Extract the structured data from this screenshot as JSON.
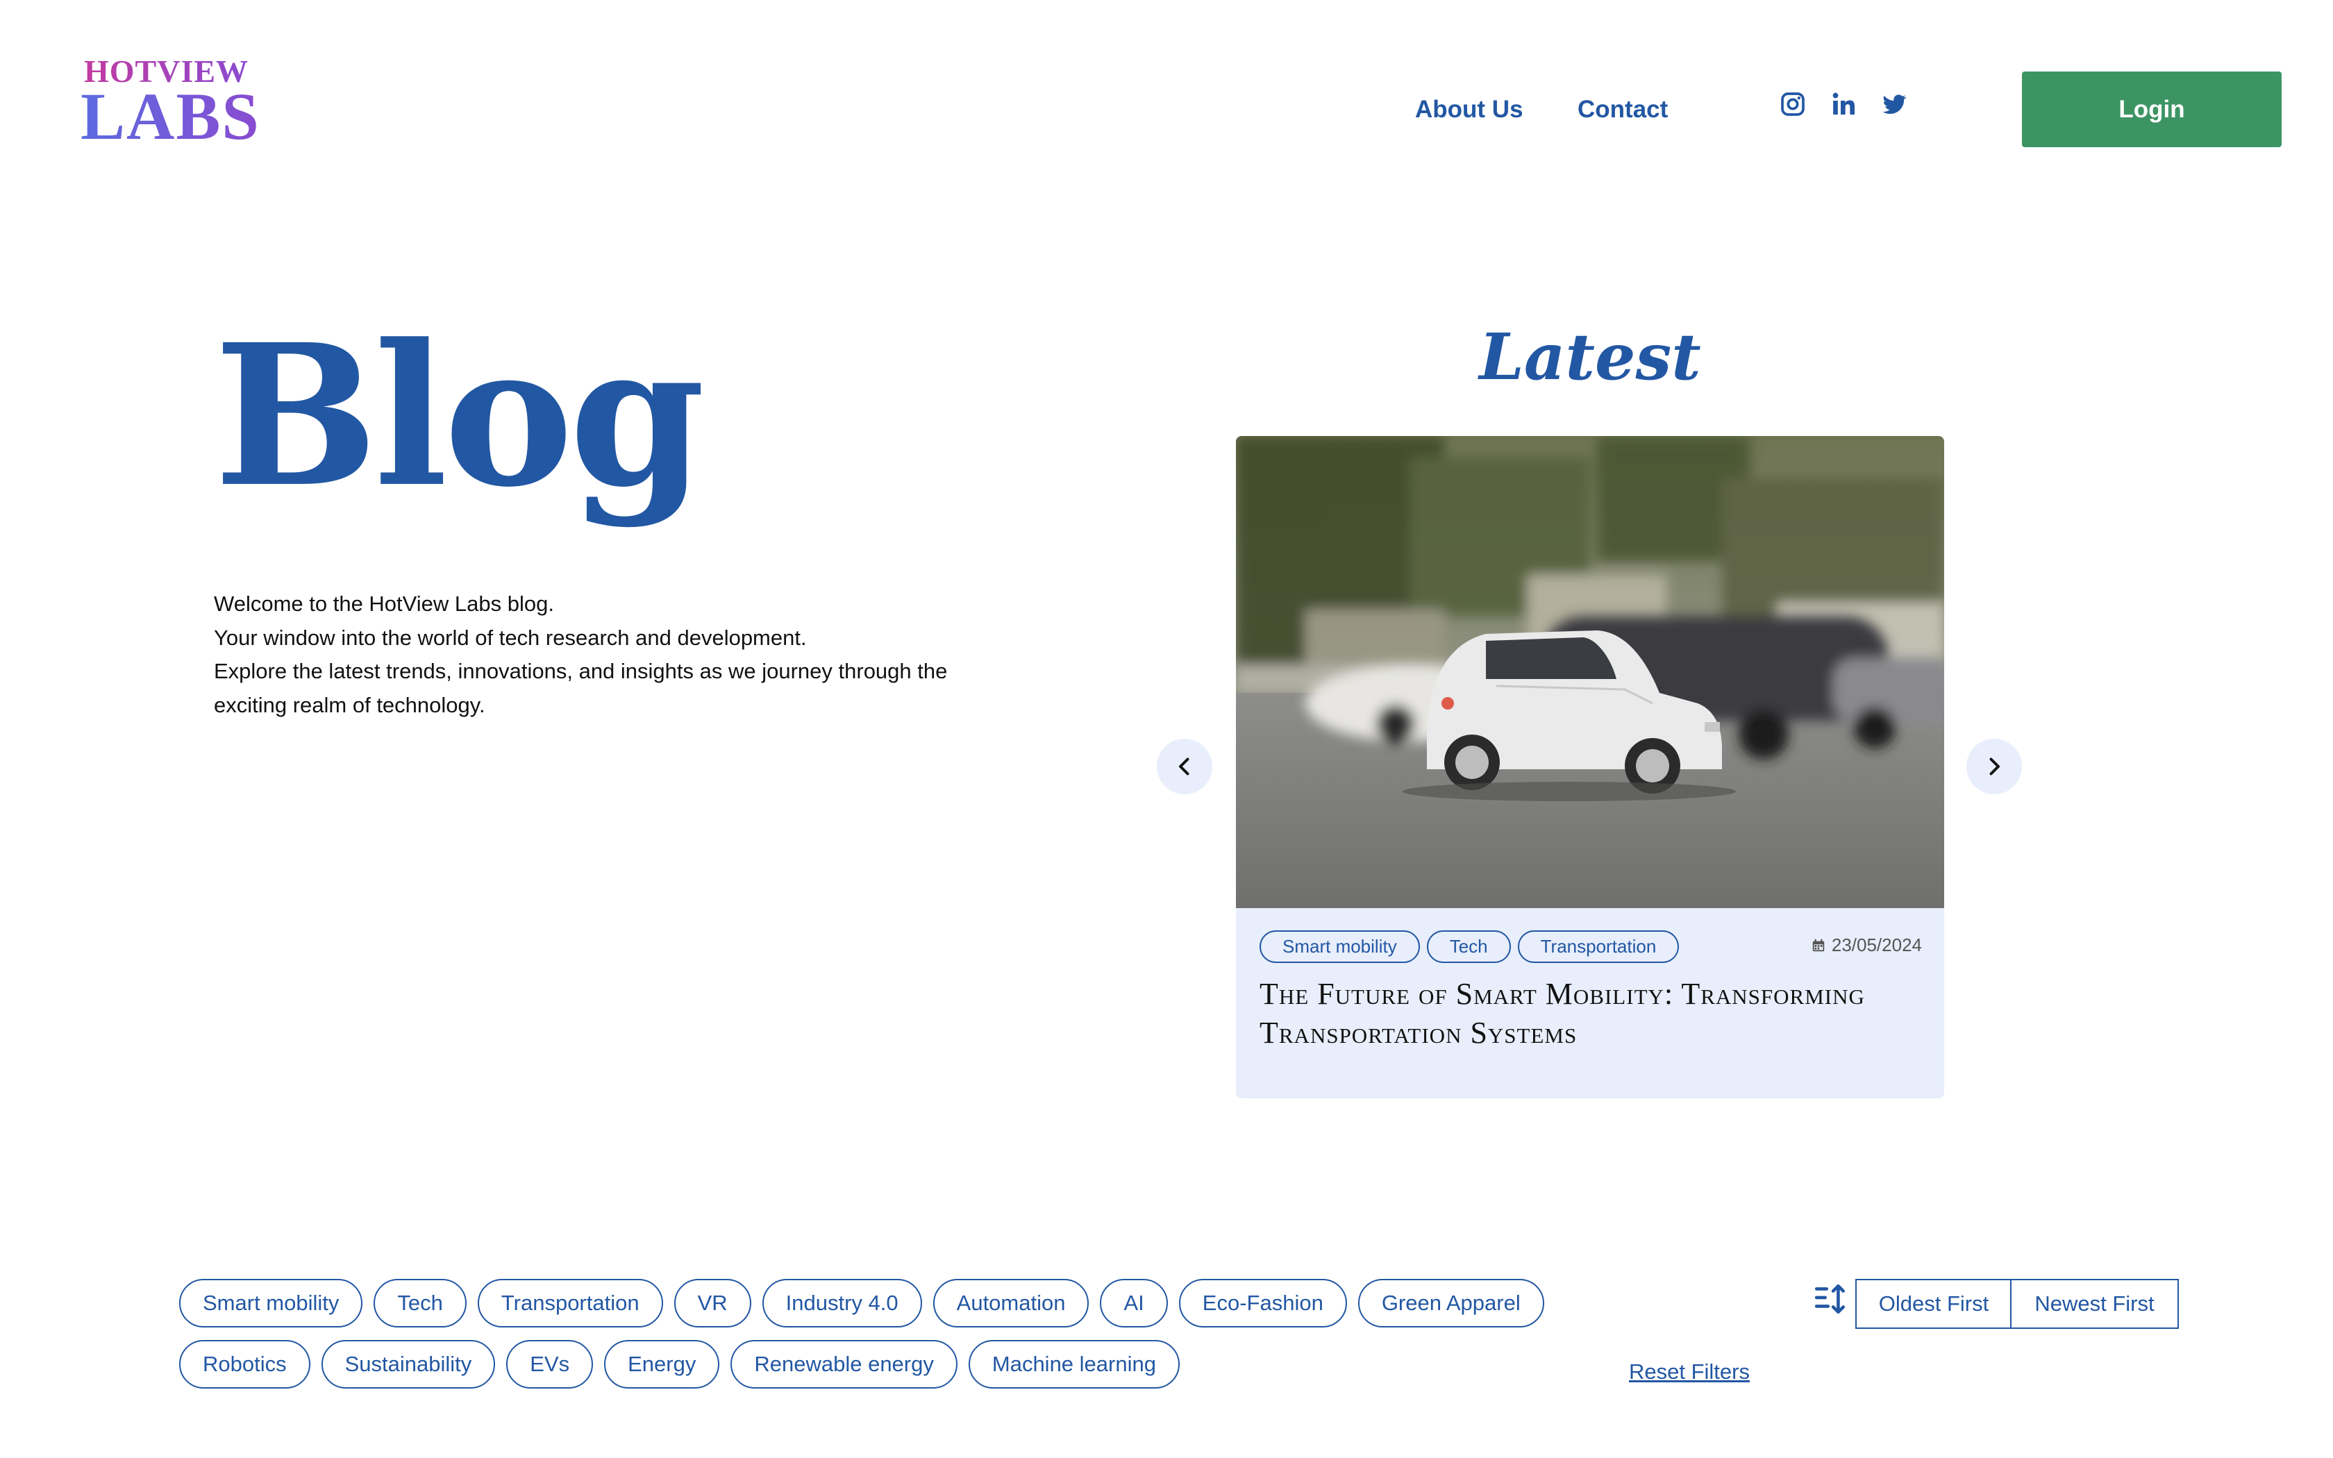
{
  "header": {
    "logo_top": "HOTVIEW",
    "logo_bottom": "LABS",
    "nav": [
      {
        "label": "About Us"
      },
      {
        "label": "Contact"
      }
    ],
    "social_icons": [
      "instagram-icon",
      "linkedin-icon",
      "twitter-icon"
    ],
    "login_label": "Login"
  },
  "hero": {
    "title": "Blog",
    "intro_lines": [
      "Welcome to the HotView Labs blog.",
      "Your window into the world of tech research and development.",
      "Explore the latest trends, innovations, and insights as we journey through the",
      "exciting realm of technology."
    ]
  },
  "latest": {
    "heading": "Latest",
    "card": {
      "tags": [
        "Smart mobility",
        "Tech",
        "Transportation"
      ],
      "date": "23/05/2024",
      "title": "The Future of Smart Mobility: Transforming Transportation Systems"
    }
  },
  "filters": {
    "row1": [
      "Smart mobility",
      "Tech",
      "Transportation",
      "VR",
      "Industry 4.0",
      "Automation",
      "AI",
      "Eco-Fashion",
      "Green Apparel"
    ],
    "row2": [
      "Robotics",
      "Sustainability",
      "EVs",
      "Energy",
      "Renewable energy",
      "Machine learning"
    ],
    "sort_oldest": "Oldest First",
    "sort_newest": "Newest First",
    "reset_label": "Reset Filters"
  },
  "colors": {
    "primary": "#2257a3",
    "login_bg": "#3d9463",
    "card_bg": "#e8eefb"
  }
}
